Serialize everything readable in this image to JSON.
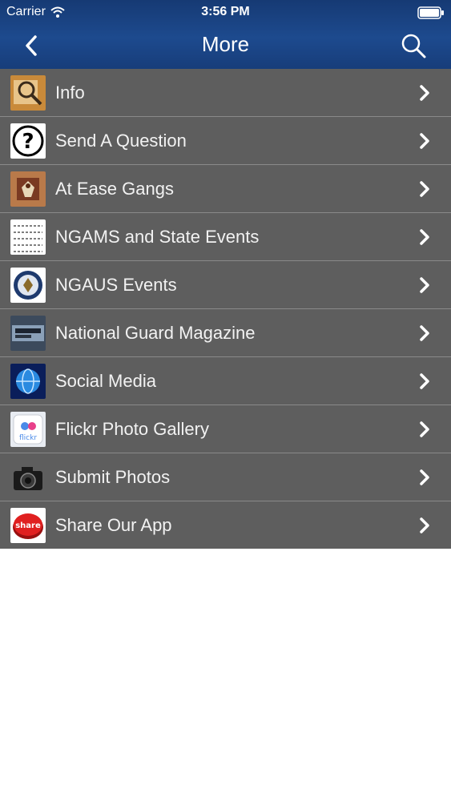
{
  "status": {
    "carrier": "Carrier",
    "time": "3:56 PM"
  },
  "nav": {
    "title": "More",
    "back_icon": "chevron-left-icon",
    "search_icon": "search-icon"
  },
  "items": [
    {
      "label": "Info",
      "icon": "magnifier-document-thumb"
    },
    {
      "label": "Send A Question",
      "icon": "question-mark-thumb"
    },
    {
      "label": "At Ease Gangs",
      "icon": "eagle-emblem-thumb"
    },
    {
      "label": "NGAMS and State Events",
      "icon": "events-list-thumb"
    },
    {
      "label": "NGAUS Events",
      "icon": "ngaus-seal-thumb"
    },
    {
      "label": "National Guard Magazine",
      "icon": "magazine-thumb"
    },
    {
      "label": "Social Media",
      "icon": "globe-thumb"
    },
    {
      "label": "Flickr Photo Gallery",
      "icon": "flickr-thumb",
      "icon_text": "flickr"
    },
    {
      "label": "Submit Photos",
      "icon": "camera-thumb"
    },
    {
      "label": "Share Our App",
      "icon": "share-button-thumb",
      "icon_text": "share"
    }
  ]
}
